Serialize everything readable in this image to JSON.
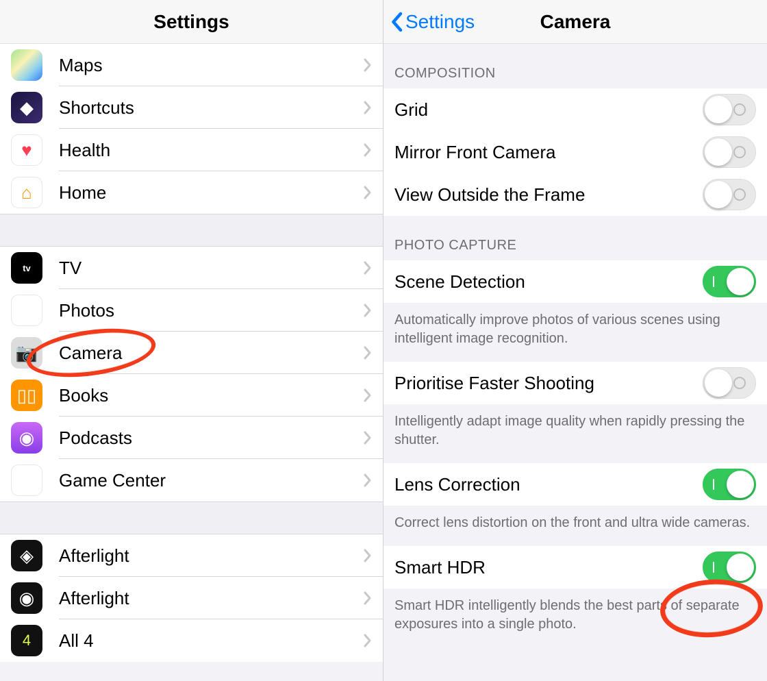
{
  "left": {
    "title": "Settings",
    "groups": [
      {
        "items": [
          {
            "id": "maps",
            "label": "Maps",
            "iconClass": "ic-maps",
            "glyph": ""
          },
          {
            "id": "shortcuts",
            "label": "Shortcuts",
            "iconClass": "ic-shortcuts",
            "glyph": "◆"
          },
          {
            "id": "health",
            "label": "Health",
            "iconClass": "ic-health",
            "glyph": "♥"
          },
          {
            "id": "home",
            "label": "Home",
            "iconClass": "ic-home",
            "glyph": "⌂"
          }
        ]
      },
      {
        "items": [
          {
            "id": "tv",
            "label": "TV",
            "iconClass": "ic-tv",
            "glyph": "tv"
          },
          {
            "id": "photos",
            "label": "Photos",
            "iconClass": "ic-photos",
            "glyph": "✿"
          },
          {
            "id": "camera",
            "label": "Camera",
            "iconClass": "ic-camera",
            "glyph": "📷",
            "highlighted": true
          },
          {
            "id": "books",
            "label": "Books",
            "iconClass": "ic-books",
            "glyph": "▯▯"
          },
          {
            "id": "podcasts",
            "label": "Podcasts",
            "iconClass": "ic-podcasts",
            "glyph": "◉"
          },
          {
            "id": "gamecenter",
            "label": "Game Center",
            "iconClass": "ic-gamecenter",
            "glyph": "●●"
          }
        ]
      },
      {
        "items": [
          {
            "id": "afterlight1",
            "label": "Afterlight",
            "iconClass": "ic-afterlight1",
            "glyph": "◈"
          },
          {
            "id": "afterlight2",
            "label": "Afterlight",
            "iconClass": "ic-afterlight2",
            "glyph": "◉"
          },
          {
            "id": "all4",
            "label": "All 4",
            "iconClass": "ic-all4",
            "glyph": "4"
          }
        ]
      }
    ]
  },
  "right": {
    "back": "Settings",
    "title": "Camera",
    "sections": [
      {
        "header": "COMPOSITION",
        "rows": [
          {
            "id": "grid",
            "label": "Grid",
            "type": "toggle",
            "value": false
          },
          {
            "id": "mirror",
            "label": "Mirror Front Camera",
            "type": "toggle",
            "value": false
          },
          {
            "id": "viewoutside",
            "label": "View Outside the Frame",
            "type": "toggle",
            "value": false
          }
        ]
      },
      {
        "header": "PHOTO CAPTURE",
        "rows": [
          {
            "id": "scenedetect",
            "label": "Scene Detection",
            "type": "toggle",
            "value": true,
            "footer": "Automatically improve photos of various scenes using intelligent image recognition."
          },
          {
            "id": "fastershoot",
            "label": "Prioritise Faster Shooting",
            "type": "toggle",
            "value": false,
            "footer": "Intelligently adapt image quality when rapidly pressing the shutter."
          },
          {
            "id": "lenscorrect",
            "label": "Lens Correction",
            "type": "toggle",
            "value": true,
            "footer": "Correct lens distortion on the front and ultra wide cameras."
          },
          {
            "id": "smarthdr",
            "label": "Smart HDR",
            "type": "toggle",
            "value": true,
            "highlighted": true,
            "footer": "Smart HDR intelligently blends the best parts of separate exposures into a single photo."
          }
        ]
      }
    ]
  }
}
